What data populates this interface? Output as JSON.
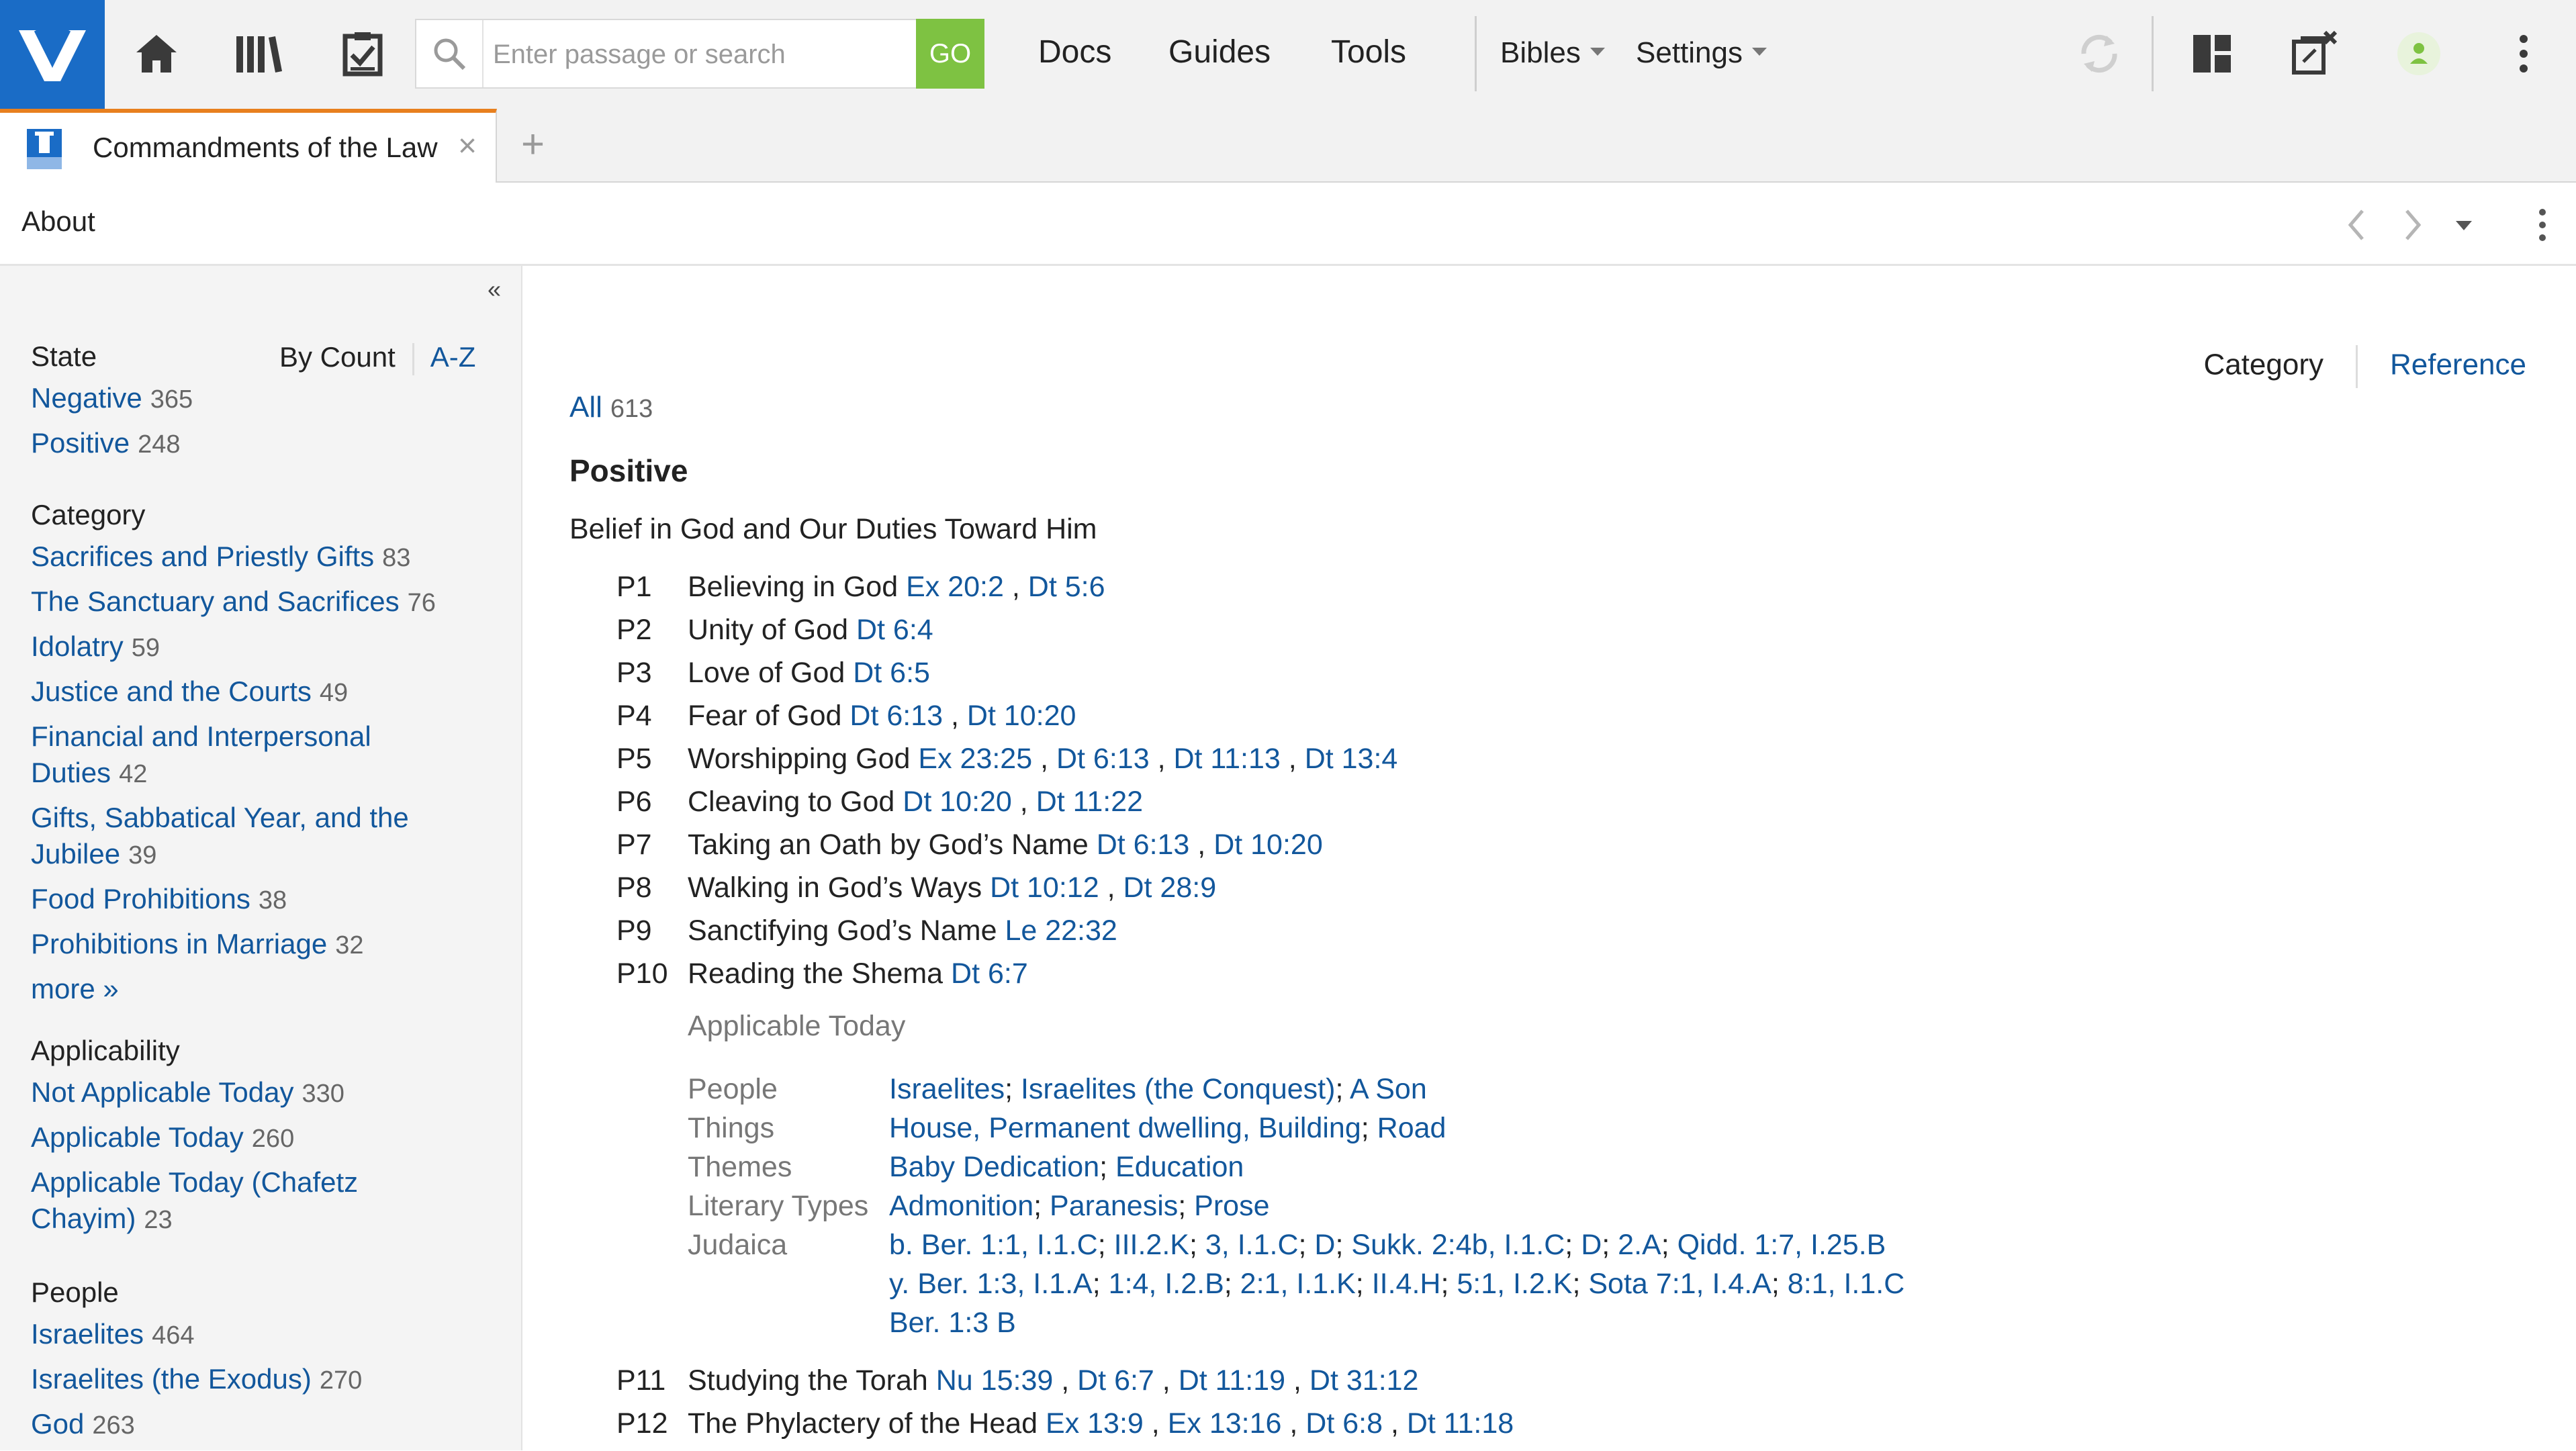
{
  "toolbar": {
    "logo_icon": "logos-logo-icon",
    "home_icon": "home-icon",
    "library_icon": "library-icon",
    "tasks_icon": "checklist-icon",
    "search_placeholder": "Enter passage or search",
    "go_label": "GO",
    "menus": [
      "Docs",
      "Guides",
      "Tools"
    ],
    "bibles_label": "Bibles",
    "settings_label": "Settings",
    "brand_color": "#1a6cc6",
    "go_color": "#7ec242",
    "online_color": "#7ec242"
  },
  "tab": {
    "title": "Commandments of the Law",
    "close_glyph": "×",
    "add_glyph": "+",
    "accent_color": "#e8801e"
  },
  "panel": {
    "header": "About"
  },
  "sidebar": {
    "collapse_glyph": "«",
    "sort_by_count": "By Count",
    "sort_az": "A-Z",
    "facets": [
      {
        "title": "State",
        "items": [
          {
            "label": "Negative",
            "count": "365"
          },
          {
            "label": "Positive",
            "count": "248"
          }
        ]
      },
      {
        "title": "Category",
        "items": [
          {
            "label": "Sacrifices and Priestly Gifts",
            "count": "83"
          },
          {
            "label": "The Sanctuary and Sacrifices",
            "count": "76"
          },
          {
            "label": "Idolatry",
            "count": "59"
          },
          {
            "label": "Justice and the Courts",
            "count": "49"
          },
          {
            "label": "Financial and Interpersonal Duties",
            "count": "42"
          },
          {
            "label": "Gifts, Sabbatical Year, and the Jubilee",
            "count": "39"
          },
          {
            "label": "Food Prohibitions",
            "count": "38"
          },
          {
            "label": "Prohibitions in Marriage",
            "count": "32"
          }
        ],
        "more": "more »"
      },
      {
        "title": "Applicability",
        "items": [
          {
            "label": "Not Applicable Today",
            "count": "330"
          },
          {
            "label": "Applicable Today",
            "count": "260"
          },
          {
            "label": "Applicable Today (Chafetz Chayim)",
            "count": "23"
          }
        ]
      },
      {
        "title": "People",
        "items": [
          {
            "label": "Israelites",
            "count": "464"
          },
          {
            "label": "Israelites (the Exodus)",
            "count": "270"
          },
          {
            "label": "God",
            "count": "263"
          }
        ]
      }
    ]
  },
  "main": {
    "view_category": "Category",
    "view_reference": "Reference",
    "all_label": "All",
    "all_count": "613",
    "section_title": "Positive",
    "subsection_title": "Belief in God and Our Duties Toward Him",
    "commandments": [
      {
        "num": "P1",
        "text": "Believing in God",
        "refs": [
          "Ex 20:2",
          "Dt 5:6"
        ]
      },
      {
        "num": "P2",
        "text": "Unity of God",
        "refs": [
          "Dt 6:4"
        ]
      },
      {
        "num": "P3",
        "text": "Love of God",
        "refs": [
          "Dt 6:5"
        ]
      },
      {
        "num": "P4",
        "text": "Fear of God",
        "refs": [
          "Dt 6:13",
          "Dt 10:20"
        ]
      },
      {
        "num": "P5",
        "text": "Worshipping God",
        "refs": [
          "Ex 23:25",
          "Dt 6:13",
          "Dt 11:13",
          "Dt 13:4"
        ]
      },
      {
        "num": "P6",
        "text": "Cleaving to God",
        "refs": [
          "Dt 10:20",
          "Dt 11:22"
        ]
      },
      {
        "num": "P7",
        "text": "Taking an Oath by God’s Name",
        "refs": [
          "Dt 6:13",
          "Dt 10:20"
        ]
      },
      {
        "num": "P8",
        "text": "Walking in God’s Ways",
        "refs": [
          "Dt 10:12",
          "Dt 28:9"
        ]
      },
      {
        "num": "P9",
        "text": "Sanctifying God’s Name",
        "refs": [
          "Le 22:32"
        ]
      },
      {
        "num": "P10",
        "text": "Reading the Shema",
        "refs": [
          "Dt 6:7"
        ]
      }
    ],
    "detail": {
      "heading": "Applicable Today",
      "rows": [
        {
          "label": "People",
          "values": [
            "Israelites",
            "Israelites (the Conquest)",
            "A Son"
          ]
        },
        {
          "label": "Things",
          "values": [
            "House, Permanent dwelling, Building",
            "Road"
          ]
        },
        {
          "label": "Themes",
          "values": [
            "Baby Dedication",
            "Education"
          ]
        },
        {
          "label": "Literary Types",
          "values": [
            "Admonition",
            "Paranesis",
            "Prose"
          ]
        }
      ],
      "judaica_label": "Judaica",
      "judaica_lines": [
        [
          "b. Ber. 1:1, I.1.C",
          "III.2.K",
          "3, I.1.C",
          "D",
          "Sukk. 2:4b, I.1.C",
          "D",
          "2.A",
          "Qidd. 1:7, I.25.B"
        ],
        [
          "y. Ber. 1:3, I.1.A",
          "1:4, I.2.B",
          "2:1, I.1.K",
          "II.4.H",
          "5:1, I.2.K",
          "Sota 7:1, I.4.A",
          "8:1, I.1.C"
        ],
        [
          "Ber. 1:3 B"
        ]
      ]
    },
    "commandments_more": [
      {
        "num": "P11",
        "text": "Studying the Torah",
        "refs": [
          "Nu 15:39",
          "Dt 6:7",
          "Dt 11:19",
          "Dt 31:12"
        ]
      },
      {
        "num": "P12",
        "text": "The Phylactery of the Head",
        "refs": [
          "Ex 13:9",
          "Ex 13:16",
          "Dt 6:8",
          "Dt 11:18"
        ]
      }
    ]
  }
}
